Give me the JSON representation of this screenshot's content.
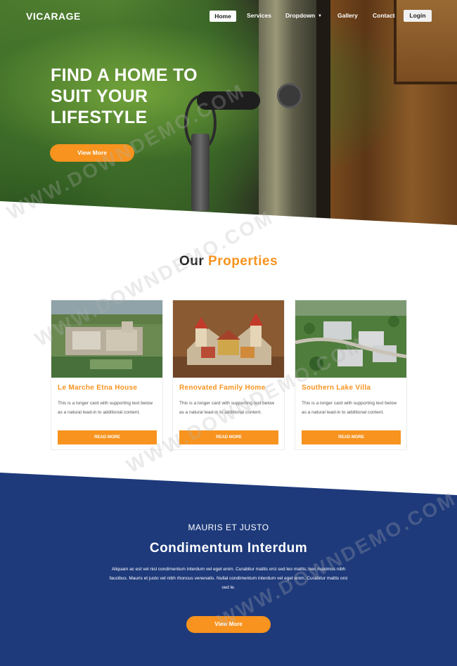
{
  "nav": {
    "brand": "VICARAGE",
    "items": [
      "Home",
      "Services",
      "Dropdown",
      "Gallery",
      "Contact"
    ],
    "login": "Login"
  },
  "hero": {
    "title_line1": "FIND A HOME TO",
    "title_line2": "SUIT YOUR",
    "title_line3": "LIFESTYLE",
    "button": "View More"
  },
  "properties": {
    "title_part1": "Our",
    "title_part2": "Properties",
    "cards": [
      {
        "name": "Le Marche Etna House",
        "text": "This is a longer card with supporting text below as a natural lead-in to additional content.",
        "button": "READ MORE"
      },
      {
        "name": "Renovated Family Home",
        "text": "This is a longer card with supporting text below as a natural lead-in to additional content.",
        "button": "READ MORE"
      },
      {
        "name": "Southern Lake Villa",
        "text": "This is a longer card with supporting text below as a natural lead-in to additional content.",
        "button": "READ MORE"
      }
    ]
  },
  "feature": {
    "subtitle": "MAURIS ET JUSTO",
    "title": "Condimentum Interdum",
    "text": "Aliquam ac est vel nisl condimentum interdum vel eget enim. Curabitur mattis orci sed leo mattis, nec maximus nibh faucibus. Mauris et justo vel nibh rhoncus venenatis. Nullal condimentum interdum vel eget enim. Curabitur mattis orci sed le.",
    "button": "View More"
  },
  "watermark": "WWW.DOWNDEMO.COM",
  "colors": {
    "accent": "#f7931e",
    "navy": "#1e3a7b",
    "white": "#ffffff"
  }
}
